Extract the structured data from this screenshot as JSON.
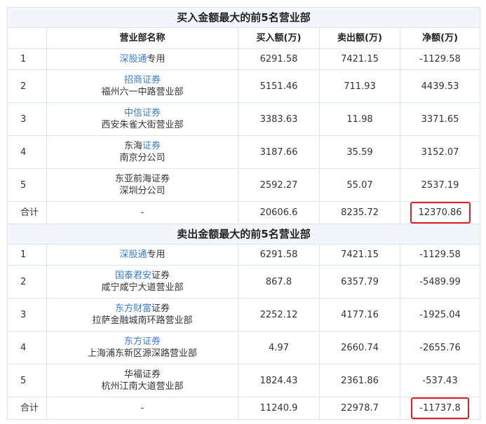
{
  "buy_table": {
    "title": "买入金额最大的前5名营业部",
    "headers": [
      "营业部名称",
      "买入额(万)",
      "卖出额(万)",
      "净额(万)"
    ],
    "rows": [
      {
        "rank": "1",
        "name_link": "深股通",
        "name_rest": "专用",
        "branch": "",
        "buy": "6291.58",
        "sell": "7421.15",
        "net": "-1129.58"
      },
      {
        "rank": "2",
        "name_link": "招商证券",
        "name_rest": "",
        "branch": "福州六一中路营业部",
        "buy": "5151.46",
        "sell": "711.93",
        "net": "4439.53"
      },
      {
        "rank": "3",
        "name_link": "中信证券",
        "name_rest": "",
        "branch": "西安朱雀大街营业部",
        "buy": "3383.63",
        "sell": "11.98",
        "net": "3371.65"
      },
      {
        "rank": "4",
        "name_pre": "东海",
        "name_link": "证券",
        "branch": "南京分公司",
        "buy": "3187.66",
        "sell": "35.59",
        "net": "3152.07"
      },
      {
        "rank": "5",
        "name_plain": "东亚前海证券",
        "branch": "深圳分公司",
        "buy": "2592.27",
        "sell": "55.07",
        "net": "2537.19"
      }
    ],
    "summary": {
      "label": "合计",
      "name": "-",
      "buy": "20606.6",
      "sell": "8235.72",
      "net": "12370.86"
    }
  },
  "sell_table": {
    "title": "卖出金额最大的前5名营业部",
    "rows": [
      {
        "rank": "1",
        "name_link": "深股通",
        "name_rest": "专用",
        "branch": "",
        "buy": "6291.58",
        "sell": "7421.15",
        "net": "-1129.58"
      },
      {
        "rank": "2",
        "name_link": "国泰君安",
        "name_rest": "证券",
        "branch": "咸宁咸宁大道营业部",
        "buy": "867.8",
        "sell": "6357.79",
        "net": "-5489.99"
      },
      {
        "rank": "3",
        "name_link": "东方财富",
        "name_rest": "证券",
        "branch": "拉萨金融城南环路营业部",
        "buy": "2252.12",
        "sell": "4177.16",
        "net": "-1925.04"
      },
      {
        "rank": "4",
        "name_link": "东方证券",
        "name_rest": "",
        "branch": "上海浦东新区源深路营业部",
        "buy": "4.97",
        "sell": "2660.74",
        "net": "-2655.76"
      },
      {
        "rank": "5",
        "name_plain": "华福证券",
        "branch": "杭州江南大道营业部",
        "buy": "1824.43",
        "sell": "2361.86",
        "net": "-537.43"
      }
    ],
    "summary": {
      "label": "合计",
      "name": "-",
      "buy": "11240.9",
      "sell": "22978.7",
      "net": "-11737.8"
    }
  },
  "colors": {
    "link": "#3a7dd1",
    "highlight": "#e02020",
    "title_bg": "#f2f5fa",
    "border": "#dfe3ea"
  }
}
